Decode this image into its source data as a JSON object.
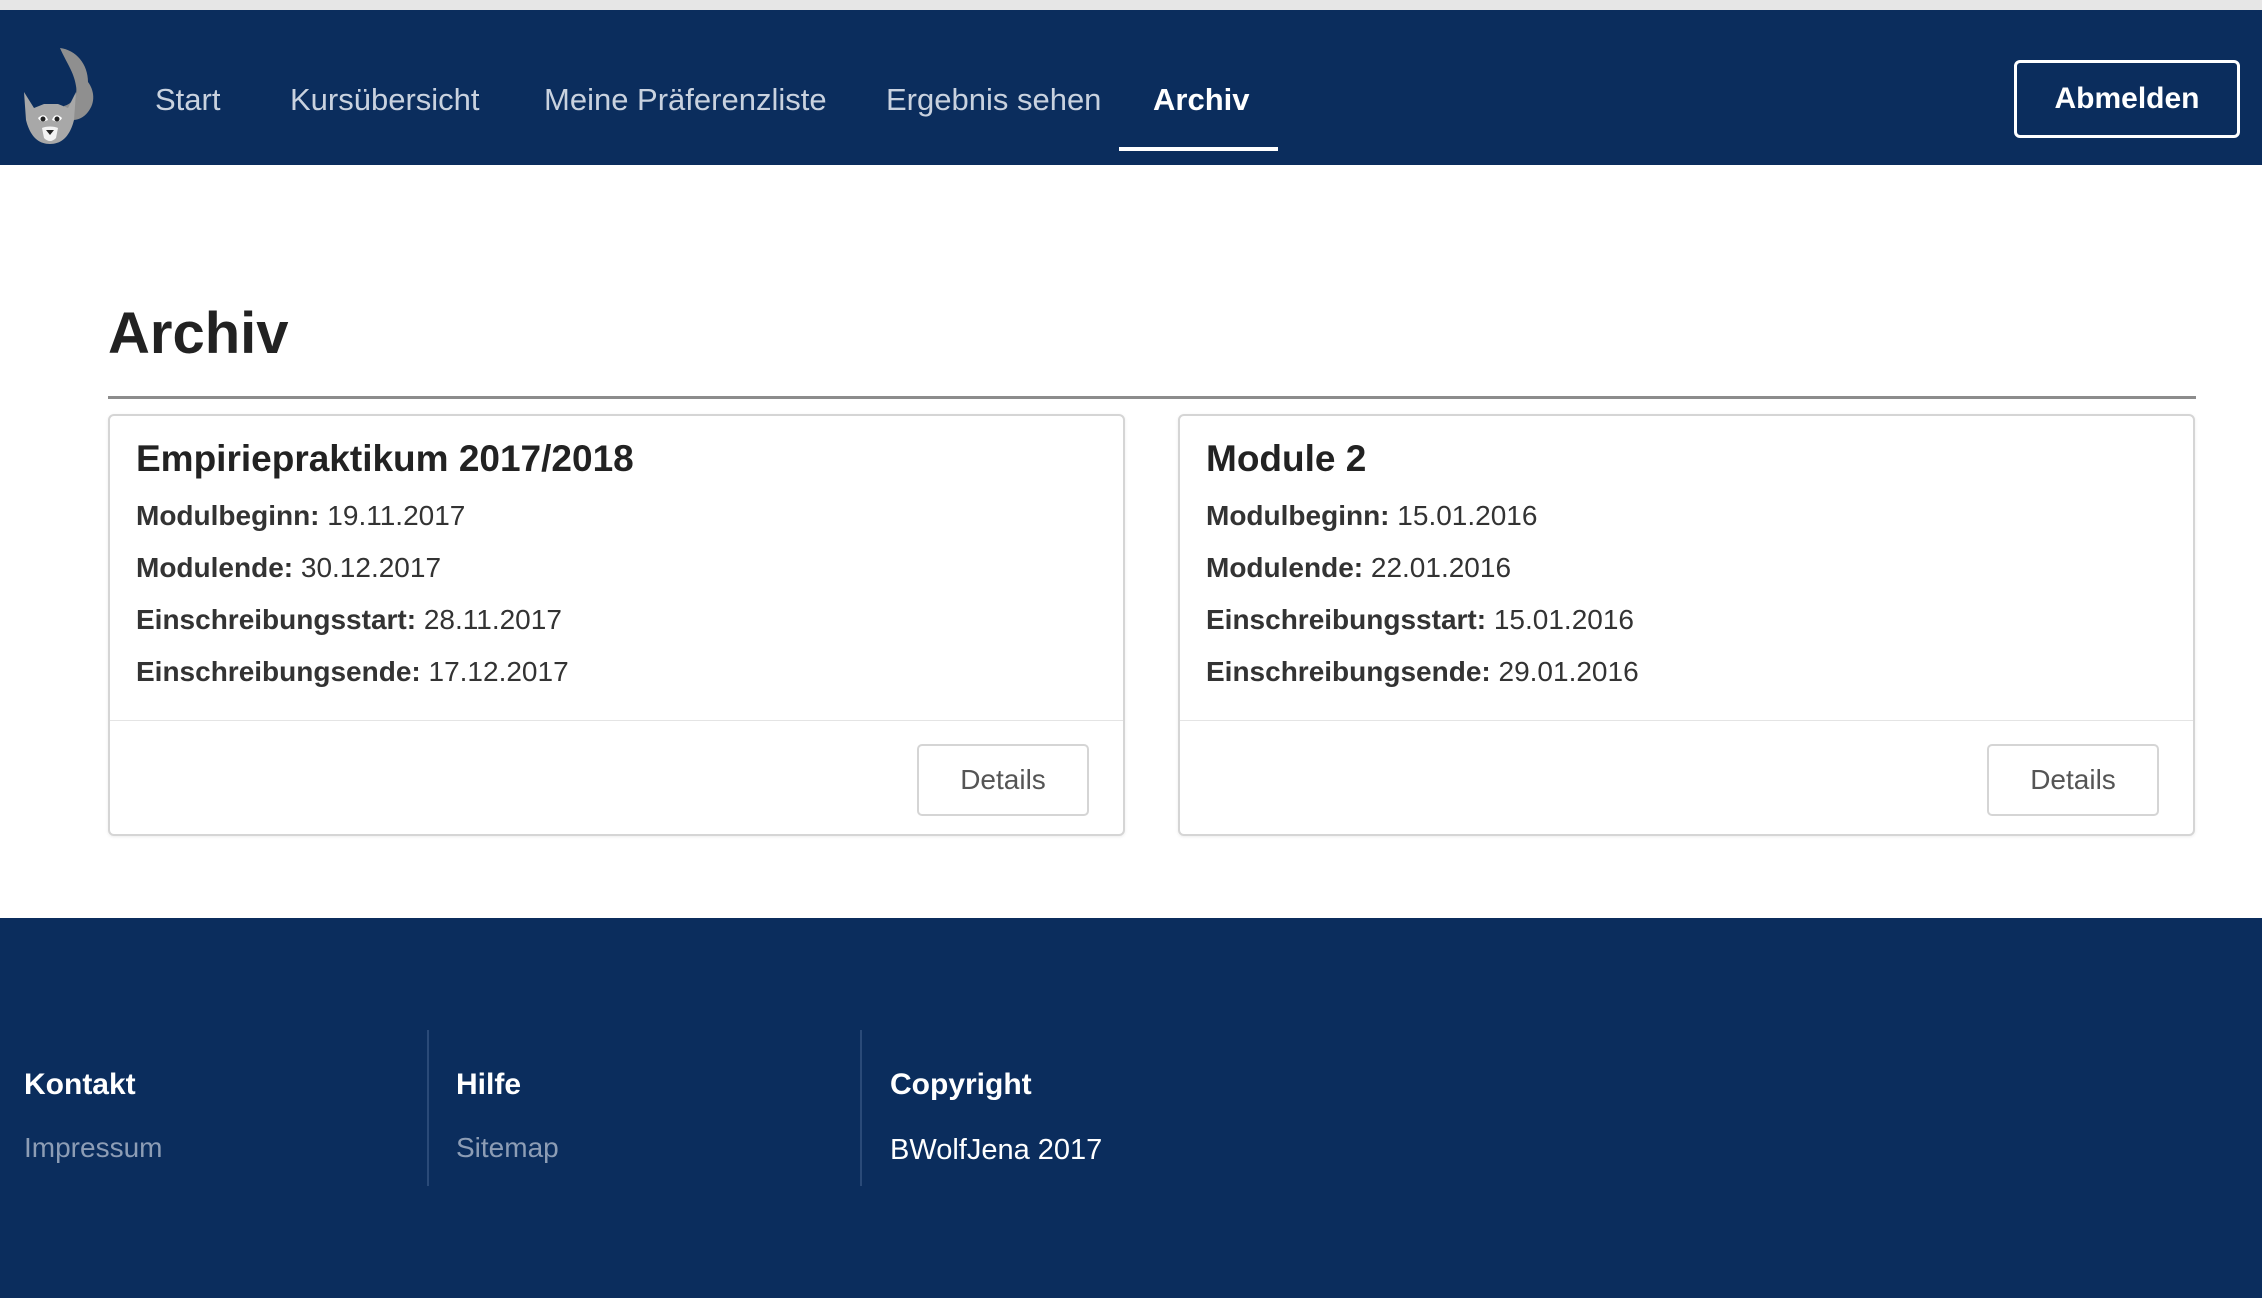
{
  "nav": {
    "items": [
      {
        "label": "Start"
      },
      {
        "label": "Kursübersicht"
      },
      {
        "label": "Meine Präferenzliste"
      },
      {
        "label": "Ergebnis sehen"
      },
      {
        "label": "Archiv"
      }
    ],
    "active": "Archiv",
    "logout_label": "Abmelden"
  },
  "page": {
    "title": "Archiv"
  },
  "labels": {
    "start": "Modulbeginn:",
    "end": "Modulende:",
    "enroll_start": "Einschreibungsstart:",
    "enroll_end": "Einschreibungsende:",
    "details": "Details"
  },
  "cards": [
    {
      "title": "Empiriepraktikum 2017/2018",
      "start": "19.11.2017",
      "end": "30.12.2017",
      "enroll_start": "28.11.2017",
      "enroll_end": "17.12.2017"
    },
    {
      "title": "Module 2",
      "start": "15.01.2016",
      "end": "22.01.2016",
      "enroll_start": "15.01.2016",
      "enroll_end": "29.01.2016"
    }
  ],
  "footer": {
    "kontakt": {
      "heading": "Kontakt",
      "link": "Impressum"
    },
    "hilfe": {
      "heading": "Hilfe",
      "link": "Sitemap"
    },
    "copyright": {
      "heading": "Copyright",
      "text": "BWolfJena 2017"
    }
  },
  "colors": {
    "brand_navy": "#0b2d5d",
    "nav_text": "#c9d2df",
    "footer_link": "#8d9db5",
    "logo_grey": "#9a9a9a"
  },
  "icons": {
    "logo": "wolf-logo-icon"
  }
}
